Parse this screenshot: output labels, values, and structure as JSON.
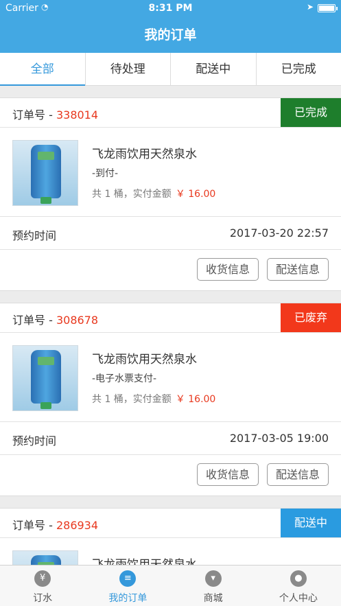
{
  "status": {
    "carrier": "Carrier",
    "time": "8:31 PM"
  },
  "header": {
    "title": "我的订单"
  },
  "tabs": [
    "全部",
    "待处理",
    "配送中",
    "已完成"
  ],
  "order_prefix": "订单号 - ",
  "time_label": "预约时间",
  "buttons": {
    "receive": "收货信息",
    "delivery": "配送信息"
  },
  "orders": [
    {
      "number": "338014",
      "status": "已完成",
      "status_color": "#1e7e2c",
      "product": "飞龙雨饮用天然泉水",
      "payment": "-到付-",
      "summary": "共 1 桶，实付金额",
      "price": "￥ 16.00",
      "time": "2017-03-20 22:57"
    },
    {
      "number": "308678",
      "status": "已废弃",
      "status_color": "#f2381b",
      "product": "飞龙雨饮用天然泉水",
      "payment": "-电子水票支付-",
      "summary": "共 1 桶，实付金额",
      "price": "￥ 16.00",
      "time": "2017-03-05 19:00"
    },
    {
      "number": "286934",
      "status": "配送中",
      "status_color": "#2a9be0",
      "product": "飞龙雨饮用天然泉水"
    }
  ],
  "tabbar": [
    {
      "label": "订水",
      "icon": "yen-icon",
      "glyph": "¥"
    },
    {
      "label": "我的订单",
      "icon": "order-list-icon",
      "glyph": "≡"
    },
    {
      "label": "商城",
      "icon": "cart-icon",
      "glyph": "▾"
    },
    {
      "label": "个人中心",
      "icon": "user-icon",
      "glyph": "●"
    }
  ],
  "colors": {
    "accent": "#43a8e3",
    "price": "#e8381e"
  }
}
